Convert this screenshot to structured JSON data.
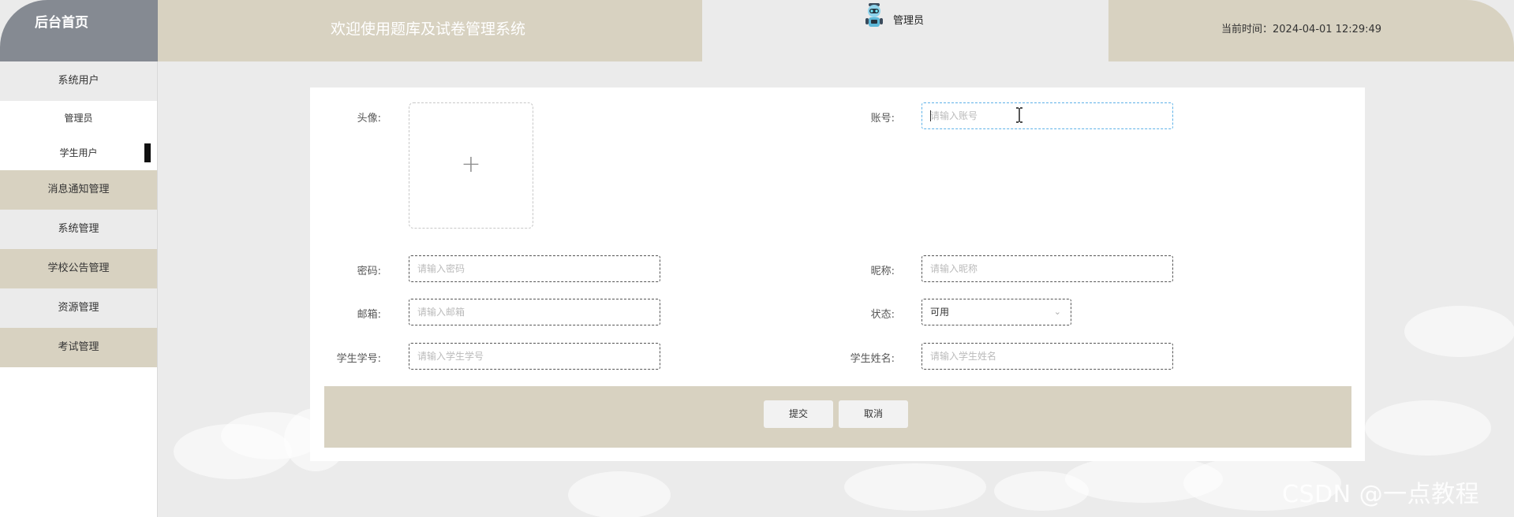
{
  "header": {
    "home_label": "后台首页",
    "system_title": "欢迎使用题库及试卷管理系统",
    "user_name": "管理员",
    "time_text": "当前时间：2024-04-01 12:29:49"
  },
  "sidebar": {
    "items": [
      {
        "label": "系统用户",
        "bg": "#ebebeb"
      },
      {
        "label": "管理员",
        "sub": true
      },
      {
        "label": "学生用户",
        "sub": true,
        "active": true
      },
      {
        "label": "消息通知管理",
        "bg": "#d8d2c1"
      },
      {
        "label": "系统管理",
        "bg": "#ebebeb"
      },
      {
        "label": "学校公告管理",
        "bg": "#d8d2c1"
      },
      {
        "label": "资源管理",
        "bg": "#ebebeb"
      },
      {
        "label": "考试管理",
        "bg": "#d8d2c1"
      }
    ]
  },
  "form": {
    "avatar_label": "头像:",
    "account_label": "账号:",
    "account_placeholder": "请输入账号",
    "password_label": "密码:",
    "password_placeholder": "请输入密码",
    "nickname_label": "昵称:",
    "nickname_placeholder": "请输入昵称",
    "email_label": "邮箱:",
    "email_placeholder": "请输入邮箱",
    "status_label": "状态:",
    "status_value": "可用",
    "student_no_label": "学生学号:",
    "student_no_placeholder": "请输入学生学号",
    "student_name_label": "学生姓名:",
    "student_name_placeholder": "请输入学生姓名",
    "submit_label": "提交",
    "cancel_label": "取消"
  },
  "watermark": "CSDN @一点教程",
  "colors": {
    "accent_beige": "#d8d2c1",
    "home_gray": "#858a92",
    "background": "#ebebeb",
    "focus_border": "#5eb2e8"
  },
  "icons": {
    "avatar": "robot-avatar-icon",
    "upload": "plus-icon",
    "select": "chevron-down-icon",
    "cursor": "text-cursor-icon"
  }
}
